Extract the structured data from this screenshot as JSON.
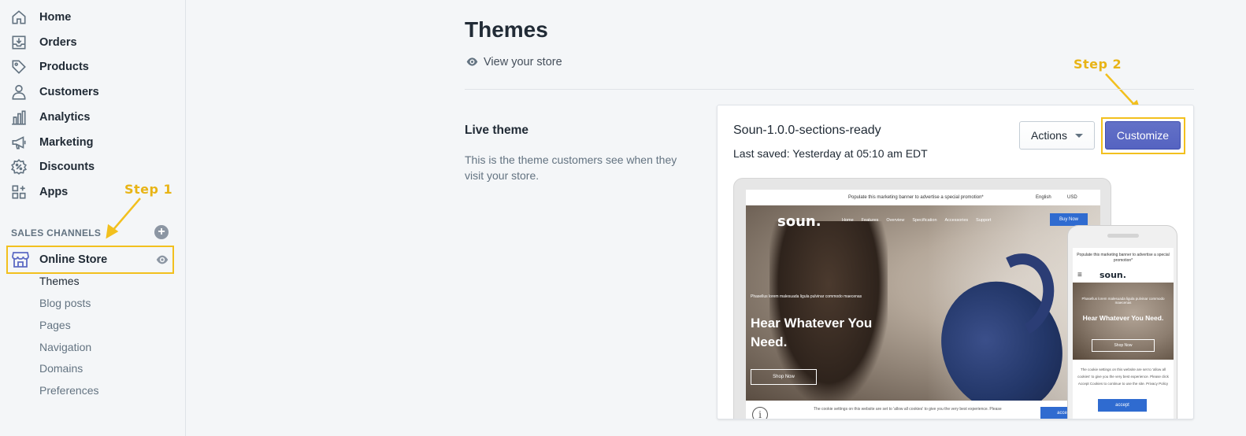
{
  "sidebar": {
    "items": [
      {
        "label": "Home",
        "icon": "home-icon"
      },
      {
        "label": "Orders",
        "icon": "orders-icon"
      },
      {
        "label": "Products",
        "icon": "tag-icon"
      },
      {
        "label": "Customers",
        "icon": "person-icon"
      },
      {
        "label": "Analytics",
        "icon": "bar-chart-icon"
      },
      {
        "label": "Marketing",
        "icon": "megaphone-icon"
      },
      {
        "label": "Discounts",
        "icon": "discount-icon"
      },
      {
        "label": "Apps",
        "icon": "apps-icon"
      }
    ],
    "sales_channels_title": "SALES CHANNELS",
    "online_store": "Online Store",
    "sub_items": [
      "Themes",
      "Blog posts",
      "Pages",
      "Navigation",
      "Domains",
      "Preferences"
    ]
  },
  "annotations": {
    "step1": "Step 1",
    "step2": "Step 2",
    "highlight_color": "#f2c01e"
  },
  "main": {
    "title": "Themes",
    "view_store": "View your store",
    "live_theme_heading": "Live theme",
    "live_theme_desc": "This is the theme customers see when they visit your store.",
    "theme_name": "Soun-1.0.0-sections-ready",
    "last_saved": "Last saved: Yesterday at 05:10 am EDT",
    "actions_label": "Actions",
    "customize_label": "Customize"
  },
  "preview": {
    "promo": "Populate this marketing banner to advertise a special promotion*",
    "language": "English",
    "currency": "USD",
    "logo": "soun.",
    "nav": [
      "Home",
      "Features",
      "Overview",
      "Specification",
      "Accessories",
      "Support"
    ],
    "buy_now": "Buy Now",
    "hero_sub": "Phasellus lorem malesuada ligula pulvinar commodo maecenas",
    "headline": "Hear Whatever You Need.",
    "shop_now": "Shop Now",
    "cookie_desktop": "The cookie settings on this website are set to 'allow all cookies' to give you the very best experience. Please",
    "accept": "accept",
    "mobile_promo": "Populate this marketing banner to advertise a special promotion*",
    "mobile_sub": "Phasellus lorem malesuada ligula pulvinar commodo maecenas",
    "mobile_headline": "Hear Whatever You Need.",
    "mobile_cookie": "The cookie settings on this website are set to 'allow all cookies' to give you the very best experience. Please click Accept Cookies to continue to use the site. Privacy Policy"
  },
  "colors": {
    "primary": "#5c6ac4",
    "accent_blue": "#2f6bd0"
  }
}
